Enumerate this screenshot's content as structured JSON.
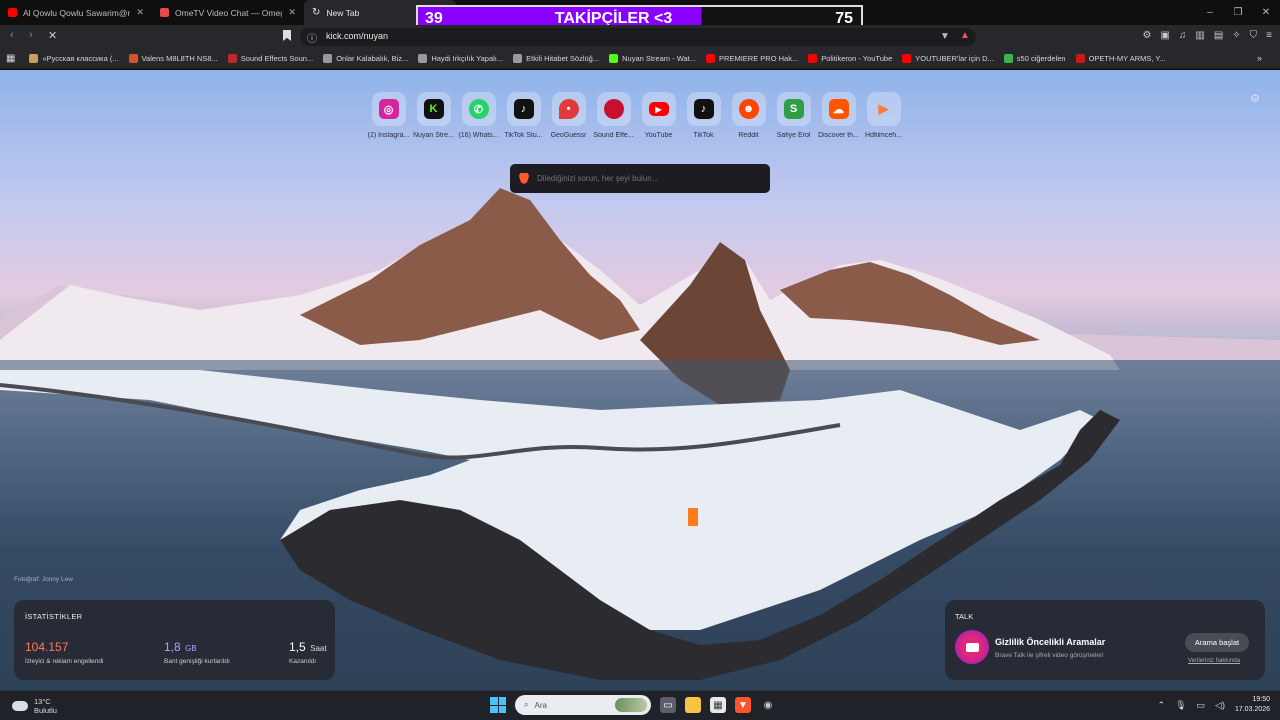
{
  "tabs": [
    {
      "title": "Al Qowlu Qowlu Sawarim@nasna...",
      "favicon_color": "#ff0000",
      "active": false
    },
    {
      "title": "OmeTV Video Chat — Omegle R...",
      "favicon_color": "#e34a4a",
      "active": false
    },
    {
      "title": "New Tab",
      "favicon_color": "#bbbbbb",
      "active": true
    }
  ],
  "overlay": {
    "left_count": "39",
    "label": "TAKİPÇİLER <3",
    "right_count": "75"
  },
  "address": {
    "url": "kick.com/nuyan"
  },
  "bookmarks": [
    {
      "label": "«Русская классика (...",
      "color": "#c9a15a"
    },
    {
      "label": "Valens M8L8TH NS8...",
      "color": "#d2552d"
    },
    {
      "label": "Sound Effects Soun...",
      "color": "#c0262d"
    },
    {
      "label": "Onlar Kalabalık, Biz...",
      "color": "#9a9a9a"
    },
    {
      "label": "Haydi Irkçılık Yapalı...",
      "color": "#9a9a9a"
    },
    {
      "label": "Etkili Hitabet Sözlüğ...",
      "color": "#9a9a9a"
    },
    {
      "label": "Nuyan Stream - Wat...",
      "color": "#53fc18"
    },
    {
      "label": "PREMIERE PRO Hak...",
      "color": "#ff0000"
    },
    {
      "label": "Politikeron - YouTube",
      "color": "#ff0000"
    },
    {
      "label": "YOUTUBER'lar için D...",
      "color": "#ff0000"
    },
    {
      "label": "s50 ciğerdelen",
      "color": "#3bb54a"
    },
    {
      "label": "OPETH-MY ARMS, Y...",
      "color": "#cc1a1a"
    }
  ],
  "shortcuts": [
    {
      "label": "(2) Instagra...",
      "icon": "instagram-icon",
      "color": "#d6249f",
      "glyph": "◎"
    },
    {
      "label": "Nuyan Stre...",
      "icon": "kick-icon",
      "color": "#53fc18",
      "glyph": "K"
    },
    {
      "label": "(16) Whats...",
      "icon": "whatsapp-icon",
      "color": "#25d366",
      "glyph": "✆"
    },
    {
      "label": "TikTok Stu...",
      "icon": "tiktok-icon",
      "color": "#111111",
      "glyph": "♪"
    },
    {
      "label": "GeoGuessr",
      "icon": "location-pin-icon",
      "color": "#e03a3a",
      "glyph": "●"
    },
    {
      "label": "Sound Effe...",
      "icon": "red-circle-icon",
      "color": "#c8102e",
      "glyph": "●"
    },
    {
      "label": "YouTube",
      "icon": "youtube-icon",
      "color": "#ff0000",
      "glyph": "▶"
    },
    {
      "label": "TikTok",
      "icon": "tiktok-icon",
      "color": "#111111",
      "glyph": "♪"
    },
    {
      "label": "Reddit",
      "icon": "reddit-icon",
      "color": "#ff4500",
      "glyph": "●"
    },
    {
      "label": "Safiye Erol",
      "icon": "s-letter-icon",
      "color": "#2f9e44",
      "glyph": "S"
    },
    {
      "label": "Discover th...",
      "icon": "soundcloud-icon",
      "color": "#ff5500",
      "glyph": "☁"
    },
    {
      "label": "Hdfilmceh...",
      "icon": "play-icon",
      "color": "#ff7a3d",
      "glyph": "▶"
    }
  ],
  "search": {
    "placeholder": "Dilediğinizi sorun, her şeyi bulun..."
  },
  "photo_credit": "Fotoğraf: Jonny Lew",
  "stats": {
    "heading": "İSTATİSTİKLER",
    "items": [
      {
        "value": "104.157",
        "unit": "",
        "desc": "İzleyici & reklam engellendi",
        "color": "#ff7a5c"
      },
      {
        "value": "1,8",
        "unit": "GB",
        "desc": "Bant genişliği kurtarıldı",
        "color": "#a9a4ff"
      },
      {
        "value": "1,5",
        "unit": "Saat",
        "desc": "Kazanıldı",
        "color": "#ffffff"
      }
    ]
  },
  "talk": {
    "heading": "TALK",
    "title": "Gizlilik Öncelikli Aramalar",
    "subtitle": "Brave Talk ile şifreli video görüşmeleri",
    "button": "Arama başlat",
    "link": "Verileriniz hakkında"
  },
  "taskbar": {
    "temperature": "13°C",
    "condition": "Bulutlu",
    "search_label": "Ara",
    "time": "19:50",
    "date": "17.03.2026"
  }
}
